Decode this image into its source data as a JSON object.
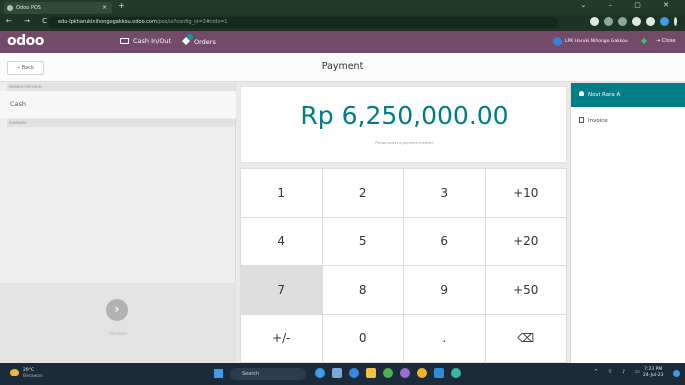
{
  "browser": {
    "tab_title": "Odoo POS",
    "tab_close": "×",
    "new_tab": "+",
    "window_controls": "⌄ – ▢ ✕",
    "nav_buttons": "← → C",
    "url_host": "edu-lpkharukinihongogakkou.odoo.com",
    "url_path": "/pos/ui?config_id=2#cids=1"
  },
  "header": {
    "logo": "odoo",
    "cash_in_out": "Cash In/Out",
    "orders": "Orders",
    "cashier": "LPK Haruki Nihongo Gakkou",
    "close": "Close"
  },
  "control_bar": {
    "back": "« Back",
    "title": "Payment"
  },
  "left": {
    "payment_method_title": "PAYMENT METHOD",
    "payment_methods": [
      "Cash"
    ],
    "summary_title": "SUMMARY",
    "validate_icon": "›",
    "validate_label": "Validate"
  },
  "center": {
    "amount": "Rp 6,250,000.00",
    "hint": "Please select a payment method."
  },
  "numpad": {
    "keys": [
      "1",
      "2",
      "3",
      "+10",
      "4",
      "5",
      "6",
      "+20",
      "7",
      "8",
      "9",
      "+50",
      "+/-",
      "0",
      ".",
      "⌫"
    ],
    "active_key": "7"
  },
  "right": {
    "customer": "Novi Rara A",
    "invoice": "Invoice"
  },
  "taskbar": {
    "temperature": "29°C",
    "weather": "Berawan",
    "search": "Search",
    "tray": "^ ⌔ ♪ ▭",
    "time": "7:23 PM",
    "date": "24-Jul-23"
  },
  "colors": {
    "odoo_header": "#714b67",
    "accent_teal": "#017e84",
    "browser_frame": "#223a28"
  }
}
